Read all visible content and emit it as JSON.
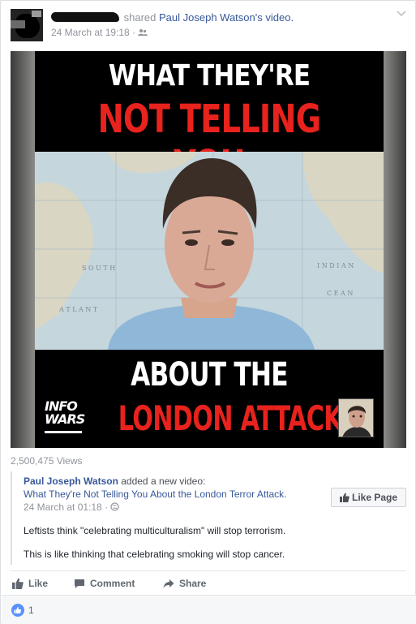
{
  "post": {
    "author_redacted": "",
    "action_text": "shared",
    "shared_from": "Paul Joseph Watson",
    "shared_suffix": "'s video.",
    "timestamp": "24 March at 19:18",
    "audience_icon": "friends-icon",
    "menu_icon": "chevron-down-icon"
  },
  "video": {
    "headline_top_line1": "WHAT THEY'RE",
    "headline_top_line2": "NOT TELLING YOU",
    "headline_bottom_line1": "ABOUT THE",
    "headline_bottom_line2": "LONDON ATTACK",
    "logo_line1": "INFO",
    "logo_line2": "WARS",
    "map_labels": [
      "S O U T H",
      "A T L A N T",
      "I N D I A N",
      "C E A N"
    ],
    "views": "2,500,475 Views"
  },
  "shared_post": {
    "page_name": "Paul Joseph Watson",
    "added_text": " added a new video: ",
    "video_title": "What They're Not Telling You About the London Terror Attack",
    "title_suffix": ".",
    "timestamp": "24 March at 01:18",
    "audience_icon": "globe-icon",
    "like_page_label": "Like Page",
    "paragraph1": "Leftists think \"celebrating multiculturalism\" will stop terrorism.",
    "paragraph2": "This is like thinking that celebrating smoking will stop cancer."
  },
  "actions": {
    "like": "Like",
    "comment": "Comment",
    "share": "Share"
  },
  "reactions": {
    "count": "1"
  },
  "colors": {
    "link": "#365899",
    "headline_red": "#e8221d",
    "reaction_blue": "#5890ff"
  }
}
